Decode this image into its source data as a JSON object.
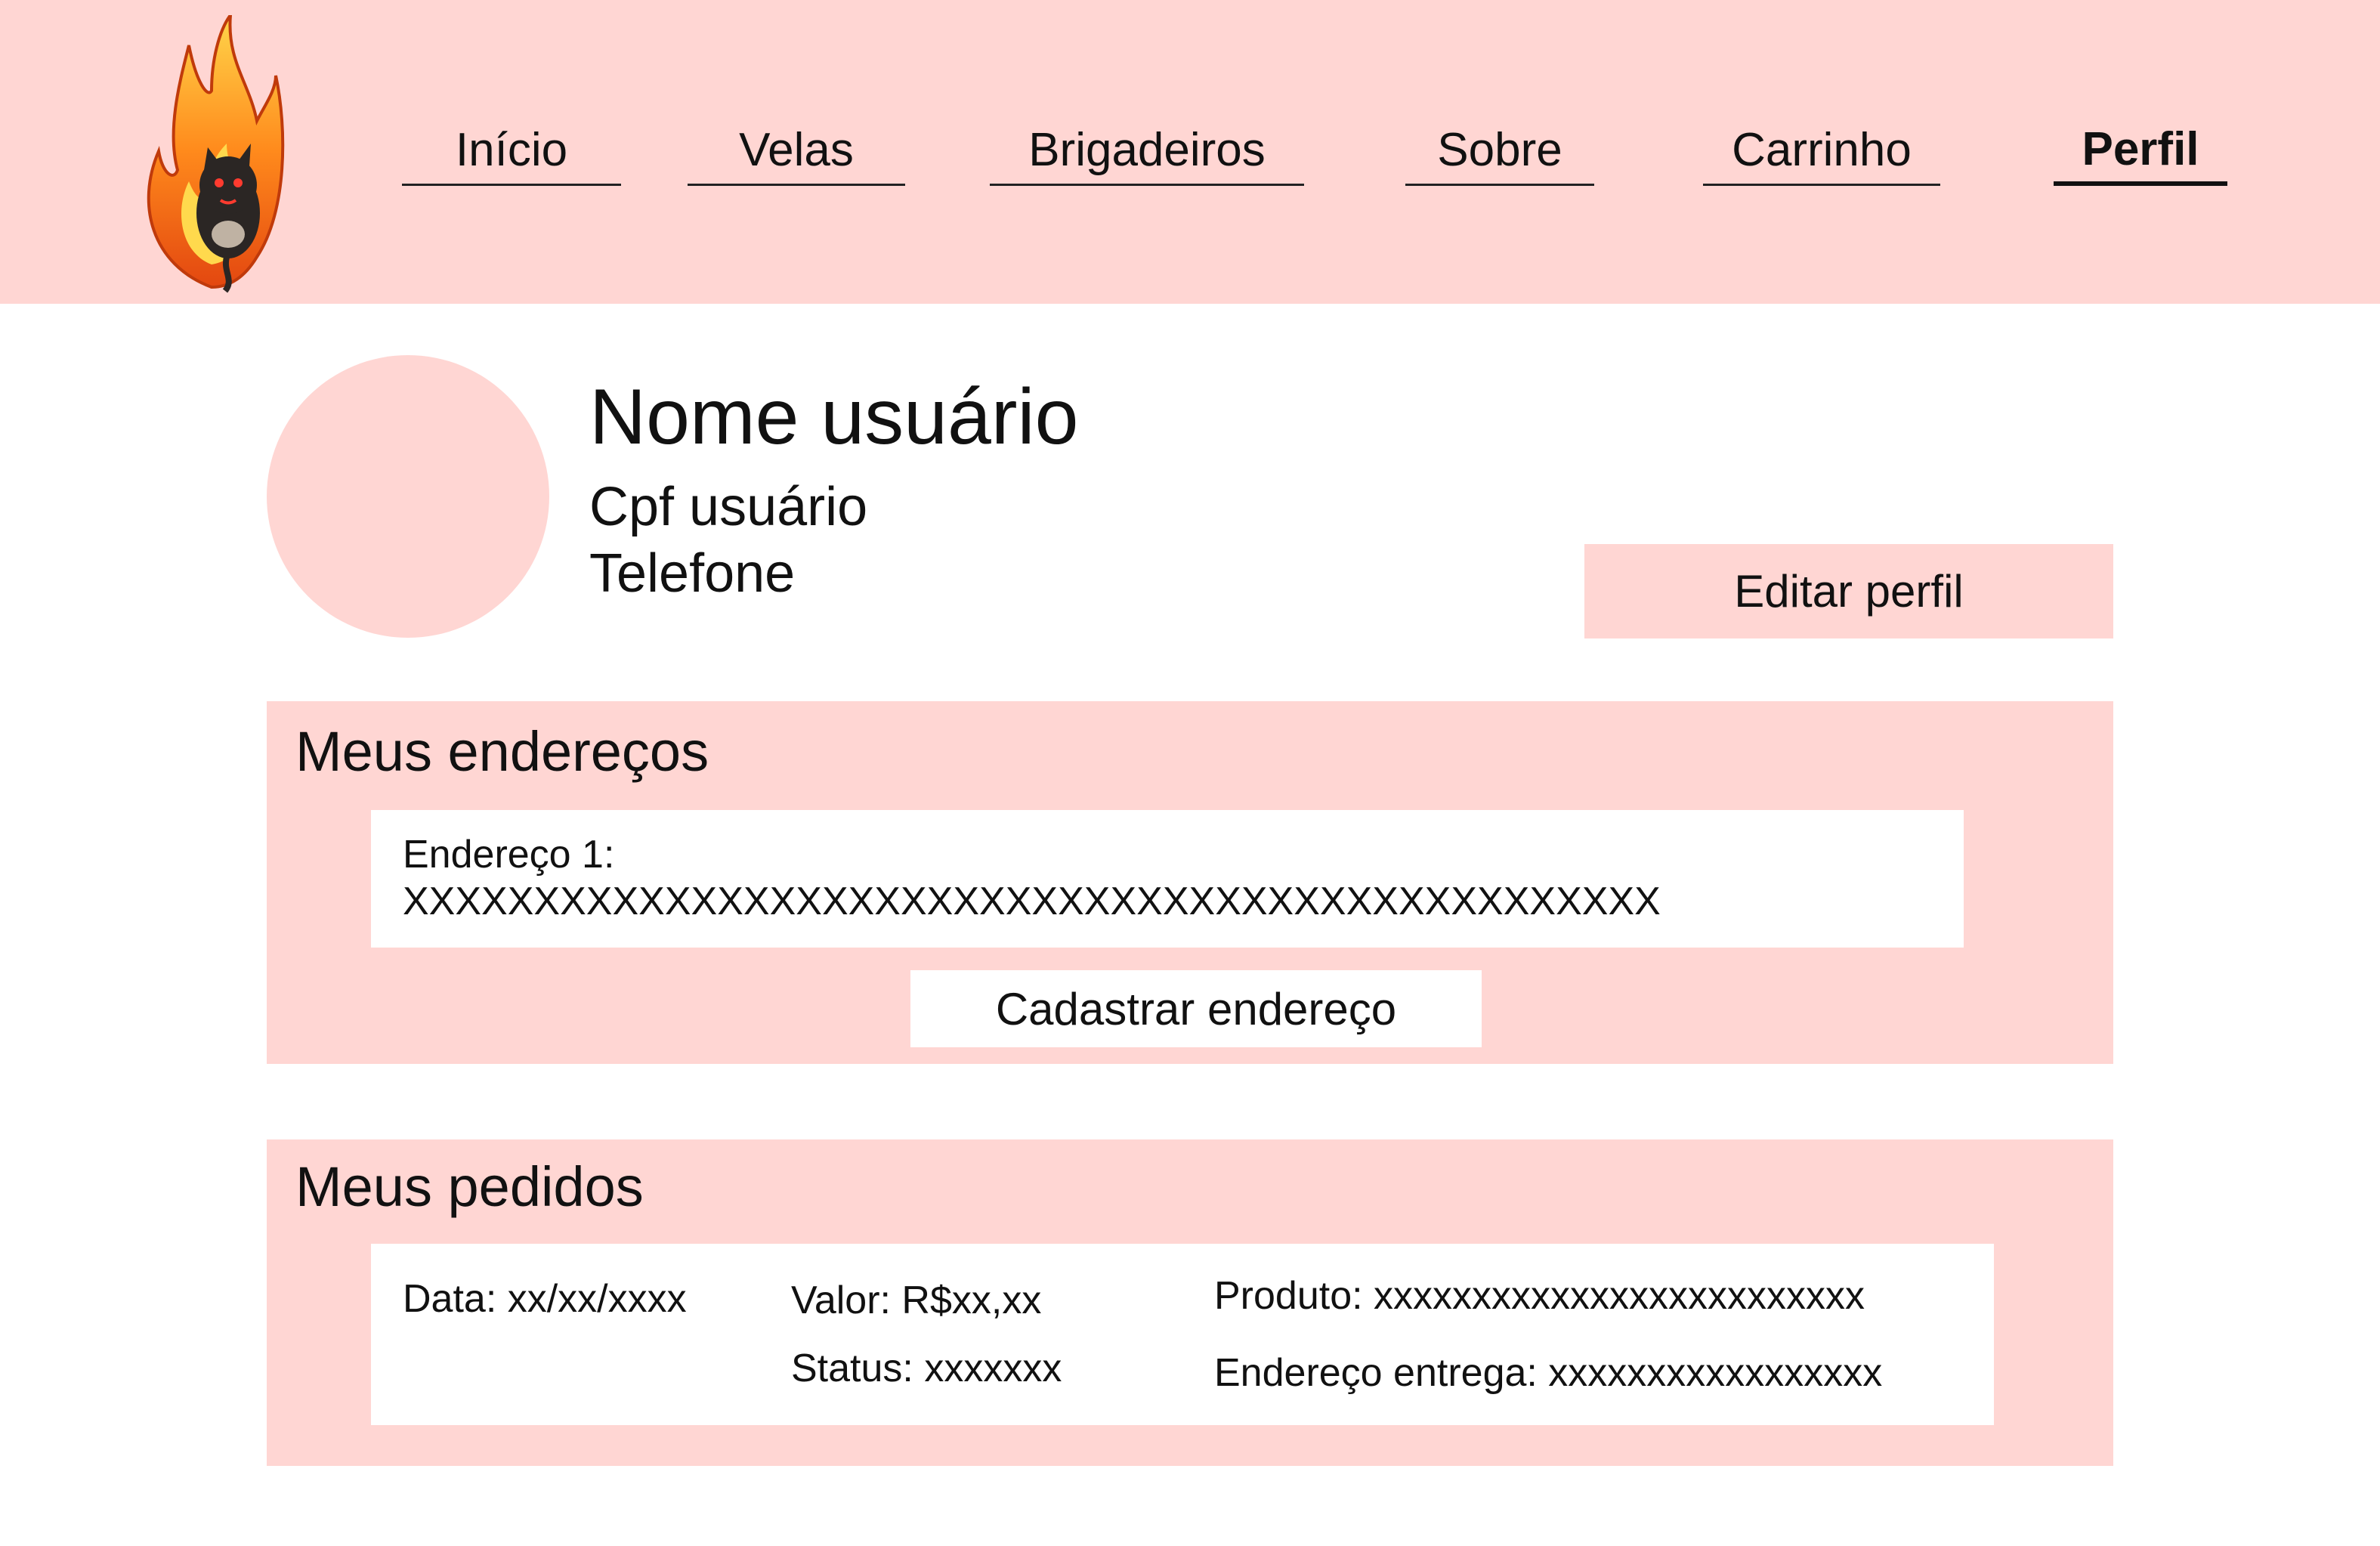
{
  "header": {
    "logo_name": "flame-cat-logo",
    "nav": [
      {
        "label": "Início",
        "active": false
      },
      {
        "label": "Velas",
        "active": false
      },
      {
        "label": "Brigadeiros",
        "active": false
      },
      {
        "label": "Sobre",
        "active": false
      },
      {
        "label": "Carrinho",
        "active": false
      },
      {
        "label": "Perfil",
        "active": true
      }
    ]
  },
  "profile": {
    "name": "Nome usuário",
    "cpf": "Cpf usuário",
    "phone": "Telefone",
    "edit_label": "Editar perfil"
  },
  "addresses": {
    "title": "Meus endereços",
    "items": [
      {
        "label": "Endereço 1:",
        "value": "XXXXXXXXXXXXXXXXXXXXXXXXXXXXXXXXXXXXXXXXXXXXXXXX"
      }
    ],
    "add_label": "Cadastrar endereço"
  },
  "orders": {
    "title": "Meus pedidos",
    "items": [
      {
        "date": "Data: xx/xx/xxxx",
        "value": "Valor: R$xx,xx",
        "status": "Status: xxxxxxx",
        "product": "Produto: xxxxxxxxxxxxxxxxxxxxxxxxx",
        "delivery": "Endereço entrega: xxxxxxxxxxxxxxxxx"
      }
    ]
  },
  "colors": {
    "accent": "#ffd6d3",
    "text": "#111111",
    "card": "#ffffff"
  }
}
